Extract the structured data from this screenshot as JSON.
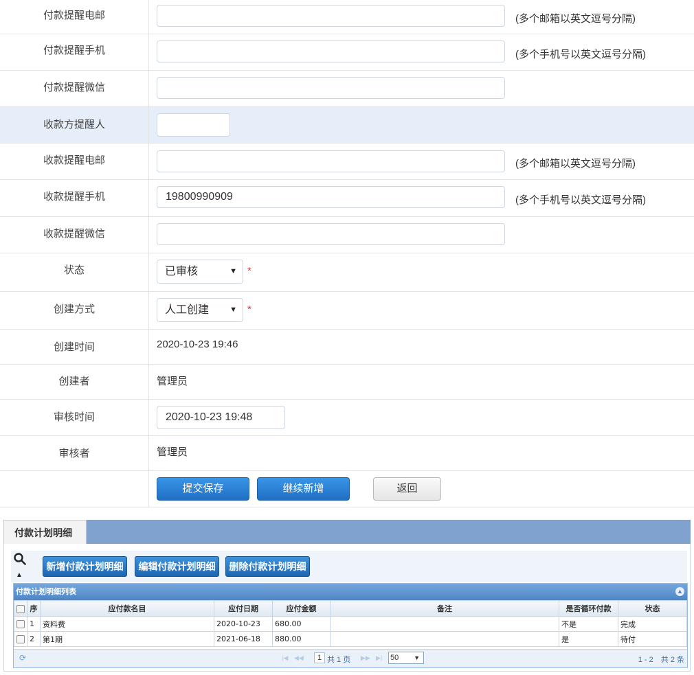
{
  "form": {
    "rows": [
      {
        "label": "付款提醒电邮",
        "value": "",
        "hint": "(多个邮箱以英文逗号分隔)"
      },
      {
        "label": "付款提醒手机",
        "value": "",
        "hint": "(多个手机号以英文逗号分隔)"
      },
      {
        "label": "付款提醒微信",
        "value": ""
      },
      {
        "label": "收款方提醒人",
        "value": ""
      },
      {
        "label": "收款提醒电邮",
        "value": "",
        "hint": "(多个邮箱以英文逗号分隔)"
      },
      {
        "label": "收款提醒手机",
        "value": "19800990909",
        "hint": "(多个手机号以英文逗号分隔)"
      },
      {
        "label": "收款提醒微信",
        "value": ""
      },
      {
        "label": "状态",
        "value": "已审核",
        "required": "*"
      },
      {
        "label": "创建方式",
        "value": "人工创建",
        "required": "*"
      },
      {
        "label": "创建时间",
        "value": "2020-10-23 19:46"
      },
      {
        "label": "创建者",
        "value": "管理员"
      },
      {
        "label": "审核时间",
        "value": "2020-10-23 19:48"
      },
      {
        "label": "审核者",
        "value": "管理员"
      }
    ],
    "buttons": {
      "submit": "提交保存",
      "continue": "继续新增",
      "back": "返回"
    }
  },
  "detail": {
    "tab": "付款计划明细",
    "toolbar": {
      "add": "新增付款计划明细",
      "edit": "编辑付款计划明细",
      "delete": "删除付款计划明细"
    },
    "grid_title": "付款计划明细列表",
    "columns": [
      "序",
      "应付款名目",
      "应付日期",
      "应付金额",
      "备注",
      "是否循环付款",
      "状态"
    ],
    "rows": [
      {
        "seq": "1",
        "name": "资料费",
        "date": "2020-10-23",
        "amount": "680.00",
        "note": "",
        "cyclic": "不是",
        "status": "完成"
      },
      {
        "seq": "2",
        "name": "第1期",
        "date": "2021-06-18",
        "amount": "880.00",
        "note": "",
        "cyclic": "是",
        "status": "待付"
      }
    ],
    "pager": {
      "page": "1",
      "total_pages": "共 1 页",
      "page_size": "50",
      "summary": "1 - 2　共 2 条"
    }
  },
  "icons": [
    "search-icon",
    "collapse-up-icon",
    "refresh-icon",
    "first-page-icon",
    "prev-page-icon",
    "next-page-icon",
    "last-page-icon",
    "dropdown-arrow-icon"
  ]
}
